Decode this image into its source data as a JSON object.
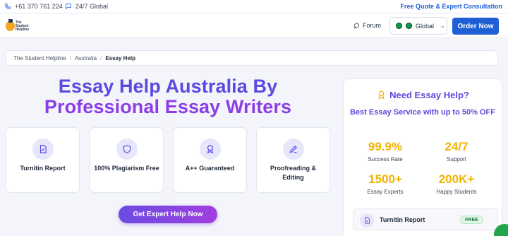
{
  "topbar": {
    "phone": "+61 370 761 224",
    "support": "24/7 Global",
    "quote_link": "Free Quote & Expert Consultation"
  },
  "header": {
    "logo_text_1": "The Student",
    "logo_text_2": "Helpline",
    "forum_label": "Forum",
    "region_label": "Global",
    "order_button": "Order Now"
  },
  "breadcrumb": {
    "items": [
      "The Student Helpline",
      "Australia",
      "Essay Help"
    ],
    "separator": "/"
  },
  "hero": {
    "title_line1": "Essay Help Australia By",
    "title_line2": "Professional Essay Writers",
    "cta": "Get Expert Help Now"
  },
  "features": [
    {
      "label": "Turnitin Report",
      "icon": "document-check-icon"
    },
    {
      "label": "100% Plagiarism Free",
      "icon": "shield-icon"
    },
    {
      "label": "A++ Guaranteed",
      "icon": "award-icon"
    },
    {
      "label": "Proofreading & Editing",
      "icon": "pencil-icon"
    }
  ],
  "panel": {
    "heading": "Need Essay Help?",
    "subheading": "Best Essay Service with up to 50% OFF",
    "stats": [
      {
        "value": "99.9%",
        "label": "Success Rate"
      },
      {
        "value": "24/7",
        "label": "Support"
      },
      {
        "value": "1500+",
        "label": "Essay Experts"
      },
      {
        "value": "200K+",
        "label": "Happy Students"
      }
    ],
    "report": {
      "label": "Turnitin Report",
      "badge": "FREE"
    }
  },
  "colors": {
    "primary": "#1f5fd6",
    "purple": "#5b49e0",
    "accent": "#f2b200"
  }
}
